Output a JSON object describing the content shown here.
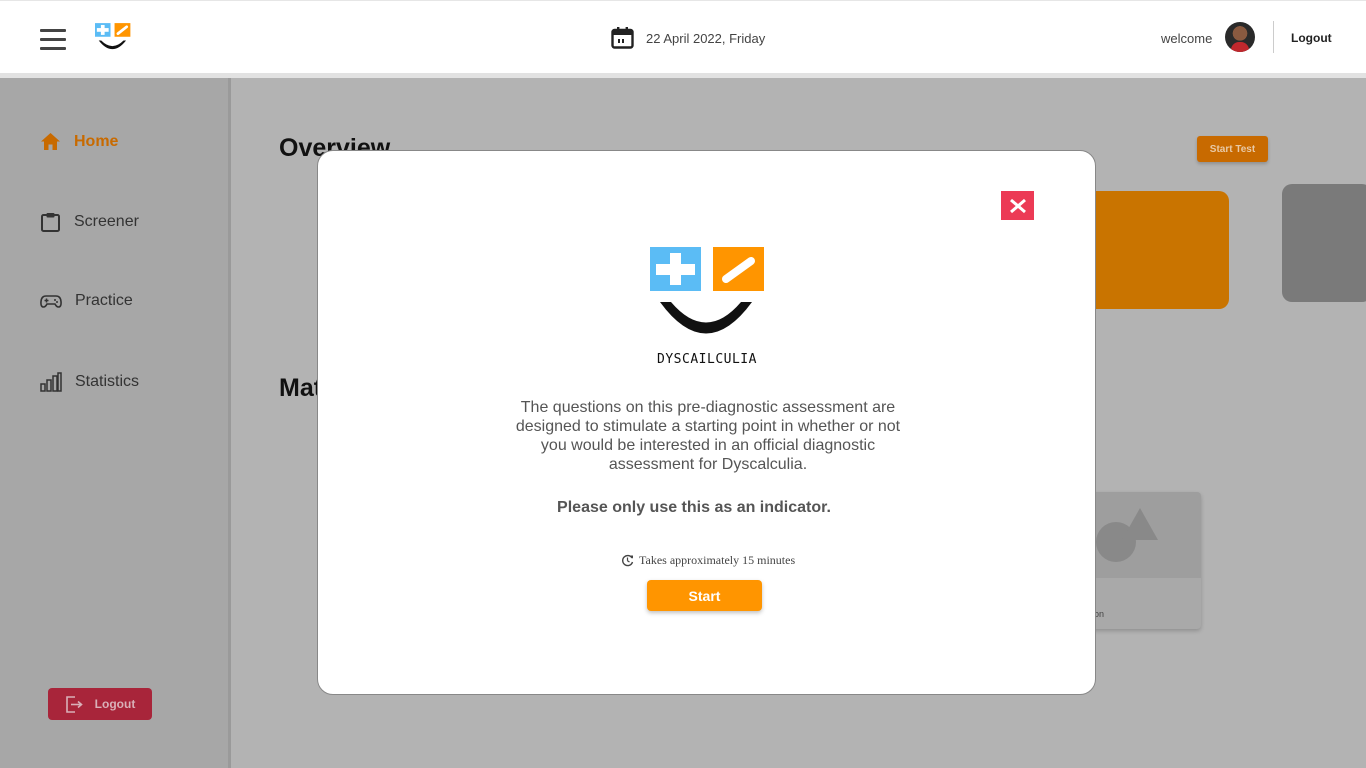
{
  "header": {
    "date": "22 April 2022, Friday",
    "welcome": "welcome",
    "logout": "Logout"
  },
  "sidebar": {
    "items": [
      {
        "label": "Home",
        "icon": "home-icon",
        "active": true
      },
      {
        "label": "Screener",
        "icon": "clipboard-icon",
        "active": false
      },
      {
        "label": "Practice",
        "icon": "gamepad-icon",
        "active": false
      },
      {
        "label": "Statistics",
        "icon": "bar-chart-icon",
        "active": false
      }
    ],
    "logout": "Logout"
  },
  "main": {
    "overview_title": "Overview",
    "section_title_visible": "Mat",
    "start_test": "Start Test",
    "practice_card_label_visible": "on"
  },
  "modal": {
    "logo_text": "DYSCAILCULIA",
    "description": "The questions on this pre-diagnostic assessment are designed to stimulate a starting point in whether or not you would be interested in an official diagnostic assessment for Dyscalculia.",
    "indicator": "Please only use this as an indicator.",
    "duration": "Takes approximately 15 minutes",
    "start": "Start"
  },
  "colors": {
    "accent_orange": "#ff9500",
    "dim_orange": "#c86a00",
    "close_red": "#ec3a55",
    "logo_blue": "#5bbcf5",
    "logout_red": "#a8253a"
  }
}
